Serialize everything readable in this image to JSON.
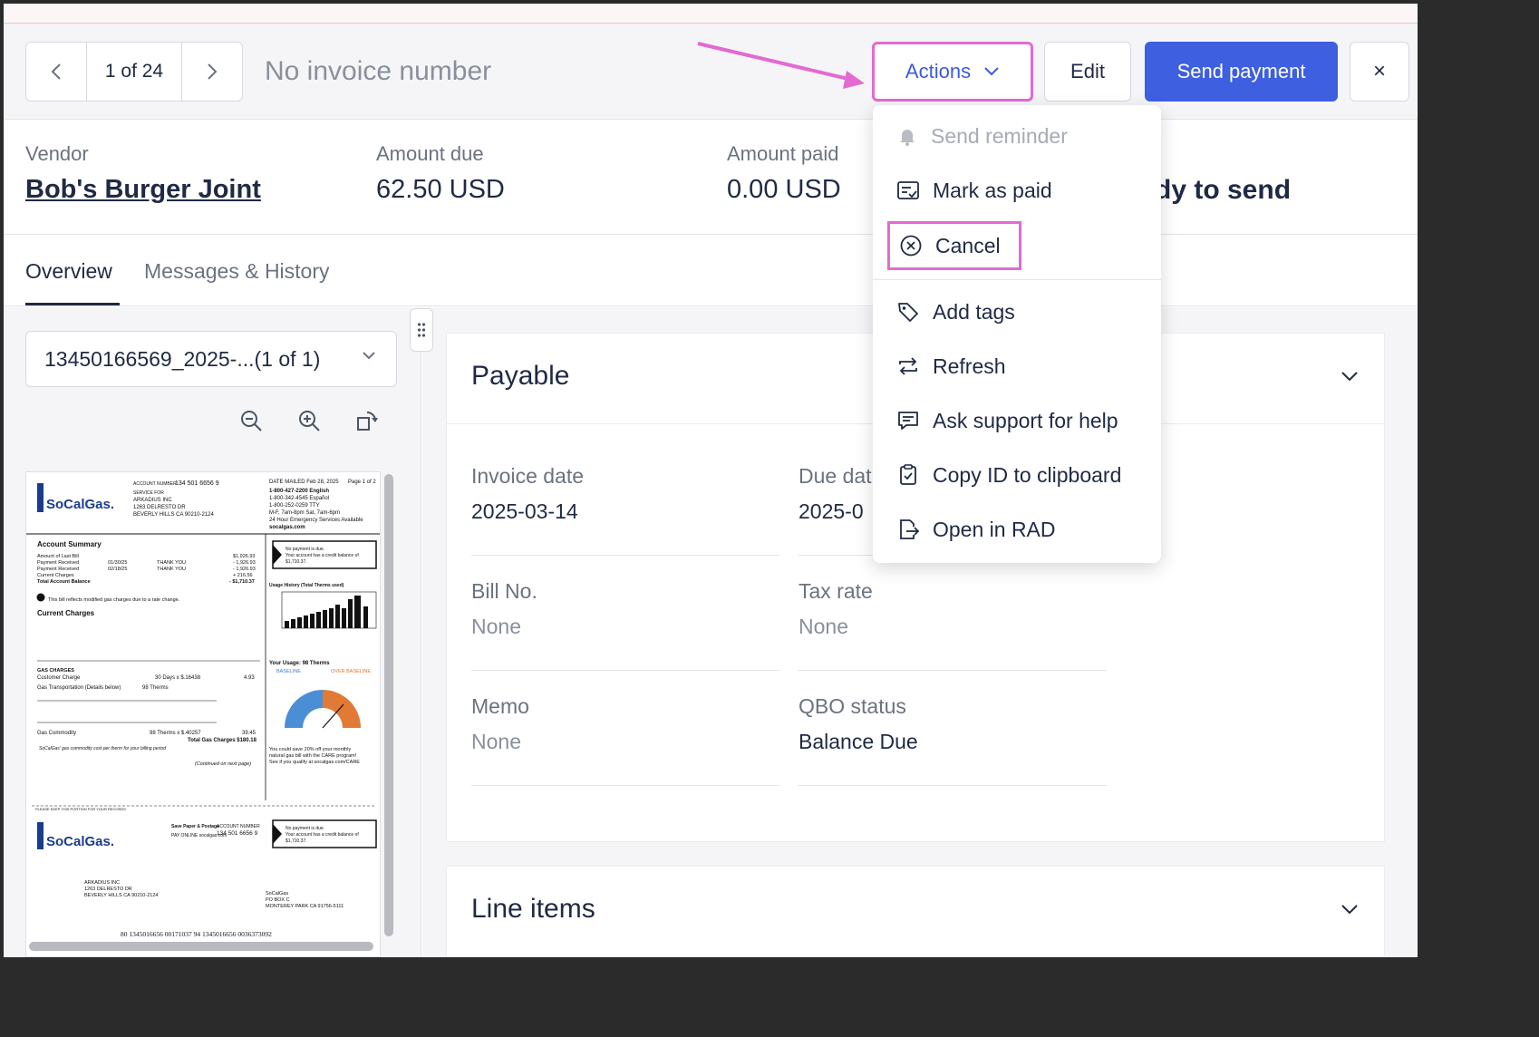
{
  "header": {
    "pager": {
      "counter": "1 of 24"
    },
    "invoice_title": "No invoice number",
    "actions_label": "Actions",
    "edit_label": "Edit",
    "send_payment_label": "Send payment",
    "close_label": "×"
  },
  "summary": {
    "vendor_label": "Vendor",
    "vendor_name": "Bob's Burger Joint",
    "amount_due_label": "Amount due",
    "amount_due": "62.50 USD",
    "amount_paid_label": "Amount paid",
    "amount_paid": "0.00 USD",
    "status_partial": "dy to send"
  },
  "tabs": {
    "overview": "Overview",
    "messages": "Messages & History"
  },
  "document": {
    "file_name": "13450166569_2025-...(1 of 1)",
    "bill": {
      "brand": "SoCalGas.",
      "account_number_label": "ACCOUNT NUMBER",
      "account_number": "134 501 6656 9",
      "service_for": "SERVICE FOR",
      "customer": [
        "ARKADIUS INC",
        "1263 DELRESTO DR",
        "BEVERLY HILLS CA 90210-2124"
      ],
      "date_mailed": "DATE MAILED Feb 28, 2025",
      "page": "Page 1 of 2",
      "phones": [
        "1-800-427-2200 English",
        "1-800-342-4545 Español",
        "1-800-252-0259 TTY",
        "M-F, 7am-8pm Sat, 7am-6pm",
        "24 Hour Emergency Services Available",
        "socalgas.com"
      ],
      "account_summary": "Account Summary",
      "summary_rows": [
        [
          "Amount of Last Bill",
          "",
          "",
          "$1,926.93"
        ],
        [
          "Payment Received",
          "01/30/25",
          "THANK YOU",
          "- 1,926.93"
        ],
        [
          "Payment Received",
          "02/18/25",
          "THANK YOU",
          "- 1,926.93"
        ],
        [
          "Current Charges",
          "",
          "",
          "+ 216.56"
        ],
        [
          "Total Account Balance",
          "",
          "",
          "- $1,710.37"
        ]
      ],
      "no_payment": [
        "No payment is due.",
        "Your account has a credit balance of",
        "$1,710.37."
      ],
      "usage_history": "Usage History (Total Therms used)",
      "rate_change_note": "This bill reflects modified gas charges due to a rate change.",
      "current_charges": "Current Charges",
      "gas_charges": "GAS CHARGES",
      "customer_charge": [
        "Customer Charge",
        "30 Days x $.16438",
        "4.93"
      ],
      "gas_transportation": "Gas Transportation (Details below)",
      "gas_transportation_therms": "98 Therms",
      "gas_commodity": [
        "Gas Commodity",
        "98 Therms x $.40257",
        "39.45"
      ],
      "total_gas_charges": "Total Gas Charges $180.18",
      "commodity_note": "SoCalGas' gas commodity cost per therm for your billing period",
      "continued": "(Continued on next page)",
      "your_usage": "Your Usage: 98 Therms",
      "baseline": "BASELINE",
      "over_baseline": "OVER BASELINE",
      "care_note": [
        "You could save 20% off your monthly",
        "natural gas bill with the CARE program!",
        "See if you qualify at socalgas.com/CARE"
      ],
      "keep_portion": "PLEASE KEEP THIS PORTION FOR YOUR RECORDS",
      "save_paper": "Save Paper & Postage",
      "pay_online": "PAY ONLINE socalgas.com",
      "remit_to": [
        "SoCalGas",
        "PO BOX C",
        "MONTEREY PARK CA 91756-5111"
      ],
      "scanline": "80 1345016656 00171037 94     1345016656 0036373092"
    }
  },
  "payable": {
    "title": "Payable",
    "fields": {
      "invoice_date_label": "Invoice date",
      "invoice_date": "2025-03-14",
      "due_date_label": "Due dat",
      "due_date": "2025-0",
      "bill_no_label": "Bill No.",
      "bill_no": "None",
      "tax_rate_label": "Tax rate",
      "tax_rate": "None",
      "memo_label": "Memo",
      "memo": "None",
      "qbo_status_label": "QBO status",
      "qbo_status": "Balance Due"
    }
  },
  "line_items": {
    "title": "Line items"
  },
  "actions_menu": {
    "items": [
      {
        "label": "Send reminder",
        "icon": "bell-icon",
        "disabled": true
      },
      {
        "label": "Mark as paid",
        "icon": "check-list-icon"
      },
      {
        "label": "Cancel",
        "icon": "x-circle-icon"
      },
      {
        "label": "Add tags",
        "icon": "tag-icon"
      },
      {
        "label": "Refresh",
        "icon": "refresh-icon"
      },
      {
        "label": "Ask support for help",
        "icon": "chat-icon"
      },
      {
        "label": "Copy ID to clipboard",
        "icon": "clipboard-icon"
      },
      {
        "label": "Open in RAD",
        "icon": "export-icon"
      }
    ]
  },
  "colors": {
    "primary": "#3d5fe0",
    "highlight": "#e26ad2",
    "text": "#1f2a44",
    "muted": "#6b7280"
  }
}
